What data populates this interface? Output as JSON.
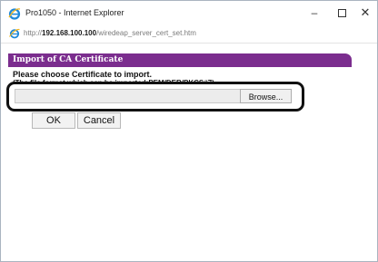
{
  "window": {
    "title": "Pro1050 - Internet Explorer",
    "minimize_glyph": "–",
    "close_glyph": "✕",
    "logo_icon": "internet-explorer-icon"
  },
  "address_bar": {
    "scheme": "http://",
    "host": "192.168.100.100",
    "path": "/wiredeap_server_cert_set.htm",
    "icon": "page-icon"
  },
  "page": {
    "section_title": "Import of CA Certificate",
    "instruction": "Please choose Certificate to import.",
    "format_note": "(The file format which can be imported:PEM/DER/PKCS#7)",
    "file_input": {
      "value": ""
    },
    "browse_label": "Browse...",
    "ok_label": "OK",
    "cancel_label": "Cancel"
  },
  "colors": {
    "section_header": "#7b2d8e",
    "highlight_border": "#111111"
  }
}
